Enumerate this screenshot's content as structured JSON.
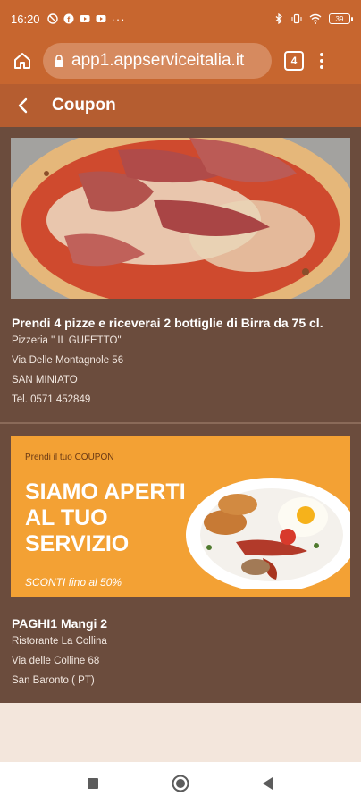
{
  "status_bar": {
    "time": "16:20",
    "left_icons": [
      "dnd-icon",
      "facebook-icon",
      "youtube-icon",
      "youtube-icon",
      "more-dots-icon"
    ],
    "right_icons": [
      "bluetooth-icon",
      "vibrate-icon",
      "wifi-icon"
    ],
    "battery_level": "39"
  },
  "browser": {
    "url": "app1.appserviceitalia.it",
    "tab_count": "4"
  },
  "app_bar": {
    "title": "Coupon"
  },
  "coupons": [
    {
      "title": "Prendi 4 pizze e riceverai 2 bottiglie di Birra da 75 cl.",
      "business": "Pizzeria \" IL GUFETTO\"",
      "address": "Via Delle Montagnole 56",
      "city": "SAN MINIATO",
      "phone": "Tel. 0571 452849"
    },
    {
      "title": "PAGHI1 Mangi 2",
      "business": "Ristorante La Collina",
      "address": "Via delle Colline 68",
      "city": "San Baronto ( PT)",
      "banner": {
        "small_text": "Prendi il tuo COUPON",
        "headline": "SIAMO APERTI AL TUO SERVIZIO",
        "sconti": "SCONTI fino al 50%"
      }
    }
  ],
  "colors": {
    "browser_bar": "#c7662f",
    "app_bar": "#b55d30",
    "content_bg": "#6b4c3d",
    "banner_orange": "#f3a134"
  }
}
